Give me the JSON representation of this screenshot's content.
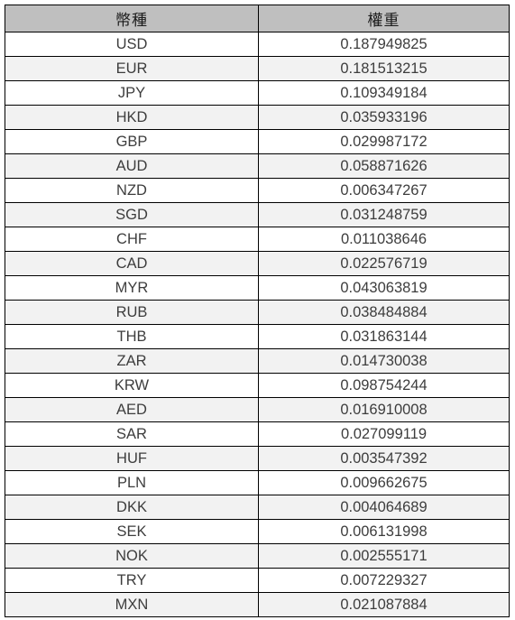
{
  "table": {
    "headers": {
      "currency": "幣種",
      "weight": "權重"
    },
    "rows": [
      {
        "currency": "USD",
        "weight": "0.187949825"
      },
      {
        "currency": "EUR",
        "weight": "0.181513215"
      },
      {
        "currency": "JPY",
        "weight": "0.109349184"
      },
      {
        "currency": "HKD",
        "weight": "0.035933196"
      },
      {
        "currency": "GBP",
        "weight": "0.029987172"
      },
      {
        "currency": "AUD",
        "weight": "0.058871626"
      },
      {
        "currency": "NZD",
        "weight": "0.006347267"
      },
      {
        "currency": "SGD",
        "weight": "0.031248759"
      },
      {
        "currency": "CHF",
        "weight": "0.011038646"
      },
      {
        "currency": "CAD",
        "weight": "0.022576719"
      },
      {
        "currency": "MYR",
        "weight": "0.043063819"
      },
      {
        "currency": "RUB",
        "weight": "0.038484884"
      },
      {
        "currency": "THB",
        "weight": "0.031863144"
      },
      {
        "currency": "ZAR",
        "weight": "0.014730038"
      },
      {
        "currency": "KRW",
        "weight": "0.098754244"
      },
      {
        "currency": "AED",
        "weight": "0.016910008"
      },
      {
        "currency": "SAR",
        "weight": "0.027099119"
      },
      {
        "currency": "HUF",
        "weight": "0.003547392"
      },
      {
        "currency": "PLN",
        "weight": "0.009662675"
      },
      {
        "currency": "DKK",
        "weight": "0.004064689"
      },
      {
        "currency": "SEK",
        "weight": "0.006131998"
      },
      {
        "currency": "NOK",
        "weight": "0.002555171"
      },
      {
        "currency": "TRY",
        "weight": "0.007229327"
      },
      {
        "currency": "MXN",
        "weight": "0.021087884"
      }
    ]
  },
  "colors": {
    "header_background": "#bfbfbf",
    "stripe_background": "#f2f2f2",
    "row_background": "#ffffff",
    "border": "#000000",
    "text": "#3d3d3d"
  }
}
